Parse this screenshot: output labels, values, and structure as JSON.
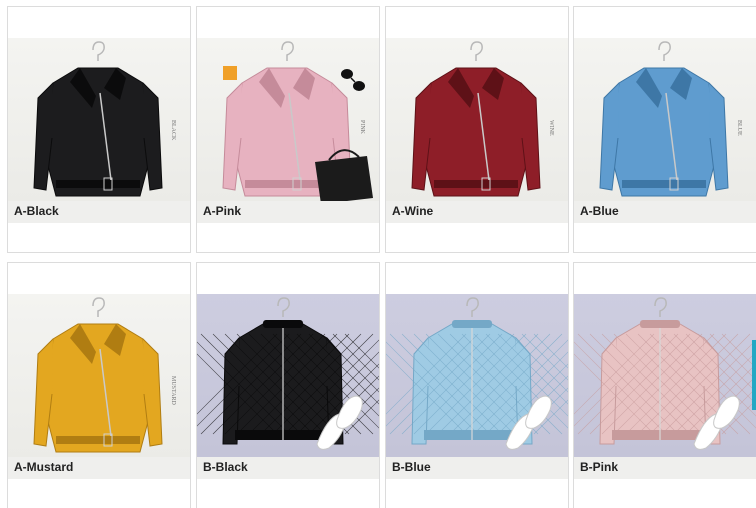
{
  "products": [
    {
      "label": "A-Black",
      "style": "biker",
      "color": "#1c1c1e",
      "shade": "#0b0b0c",
      "bg": "light",
      "tag": "BLACK",
      "extras": []
    },
    {
      "label": "A-Pink",
      "style": "biker",
      "color": "#e7b2c0",
      "shade": "#c58b9a",
      "bg": "light",
      "tag": "PINK",
      "extras": [
        "bag",
        "sunglasses",
        "poster"
      ]
    },
    {
      "label": "A-Wine",
      "style": "biker",
      "color": "#8e1e28",
      "shade": "#5e1117",
      "bg": "light",
      "tag": "WINE",
      "extras": []
    },
    {
      "label": "A-Blue",
      "style": "biker",
      "color": "#5f9ccf",
      "shade": "#3e77a6",
      "bg": "light",
      "tag": "BLUE",
      "extras": []
    },
    {
      "label": "A-Mustard",
      "style": "biker",
      "color": "#e3a720",
      "shade": "#b07d12",
      "bg": "light",
      "tag": "MUSTARD",
      "extras": []
    },
    {
      "label": "B-Black",
      "style": "bomber",
      "color": "#1b1b1d",
      "shade": "#0a0a0b",
      "bg": "lilac",
      "tag": "",
      "extras": [
        "sneakers"
      ]
    },
    {
      "label": "B-Blue",
      "style": "bomber",
      "color": "#9fcbe4",
      "shade": "#74a8c7",
      "bg": "lilac",
      "tag": "",
      "extras": [
        "sneakers"
      ]
    },
    {
      "label": "B-Pink",
      "style": "bomber",
      "color": "#e8c3c3",
      "shade": "#c79b9c",
      "bg": "lilac",
      "tag": "",
      "extras": [
        "sneakers"
      ]
    }
  ]
}
